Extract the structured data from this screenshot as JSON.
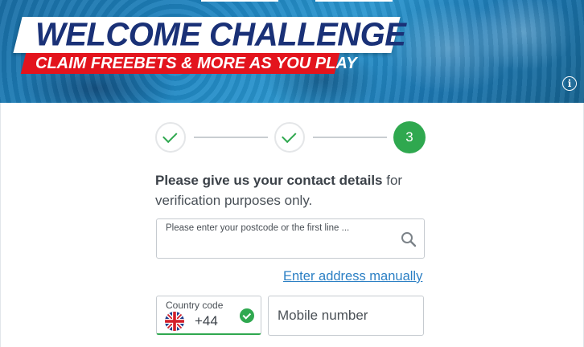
{
  "banner": {
    "title": "WELCOME CHALLENGE",
    "subtitle": "CLAIM FREEBETS & MORE AS YOU PLAY",
    "info_icon": "info-icon",
    "info_glyph": "i"
  },
  "stepper": {
    "steps": [
      {
        "state": "complete",
        "icon": "check-icon"
      },
      {
        "state": "complete",
        "icon": "check-icon"
      },
      {
        "state": "active",
        "label": "3"
      }
    ],
    "active_color": "#2fa84f"
  },
  "form": {
    "intro_bold": "Please give us your contact details",
    "intro_rest": " for verification purposes only.",
    "address_search": {
      "placeholder": "Please enter your postcode or the first line ...",
      "icon": "search-icon"
    },
    "manual_link": "Enter address manually",
    "country_code": {
      "label": "Country code",
      "value": "+44",
      "flag_icon": "uk-flag-icon",
      "status_icon": "check-circle-icon"
    },
    "mobile": {
      "placeholder": "Mobile number"
    }
  },
  "colors": {
    "brand_navy": "#1a3177",
    "brand_red": "#e3141d",
    "success_green": "#2fa84f",
    "link_blue": "#2b7fc4"
  }
}
